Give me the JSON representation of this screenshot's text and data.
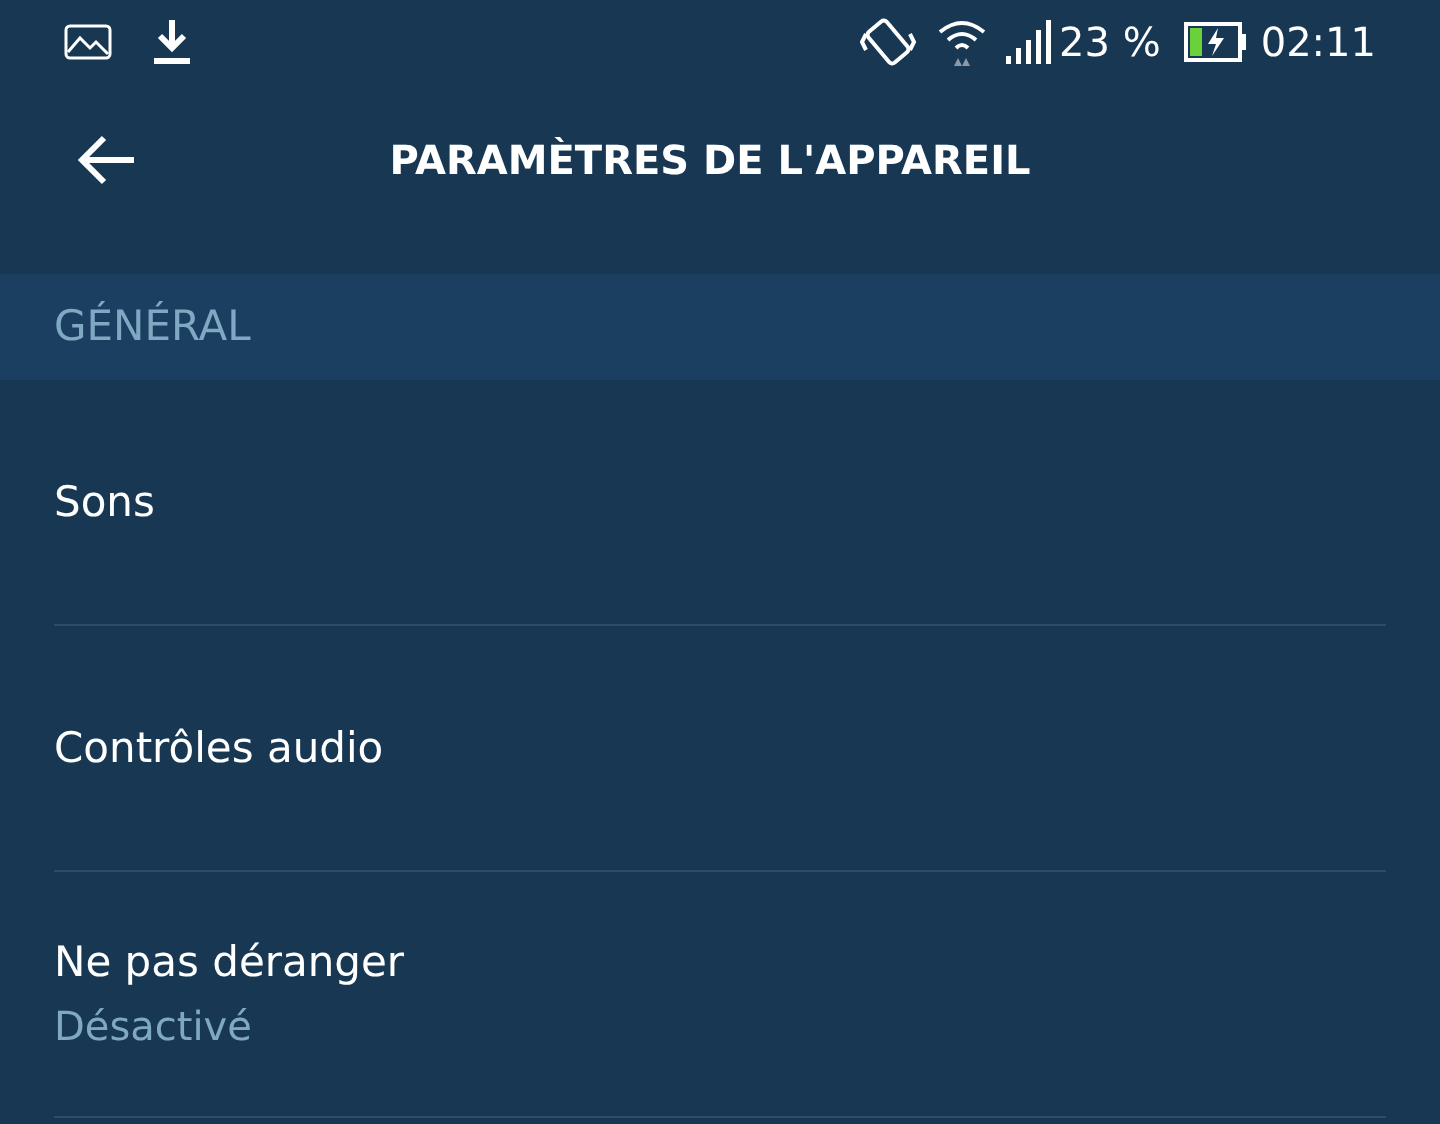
{
  "status_bar": {
    "battery_percent": "23 %",
    "time": "02:11"
  },
  "header": {
    "title": "PARAMÈTRES DE L'APPAREIL"
  },
  "section": {
    "title": "GÉNÉRAL"
  },
  "items": [
    {
      "label": "Sons"
    },
    {
      "label": "Contrôles audio"
    },
    {
      "label": "Ne pas déranger",
      "value": "Désactivé"
    }
  ]
}
